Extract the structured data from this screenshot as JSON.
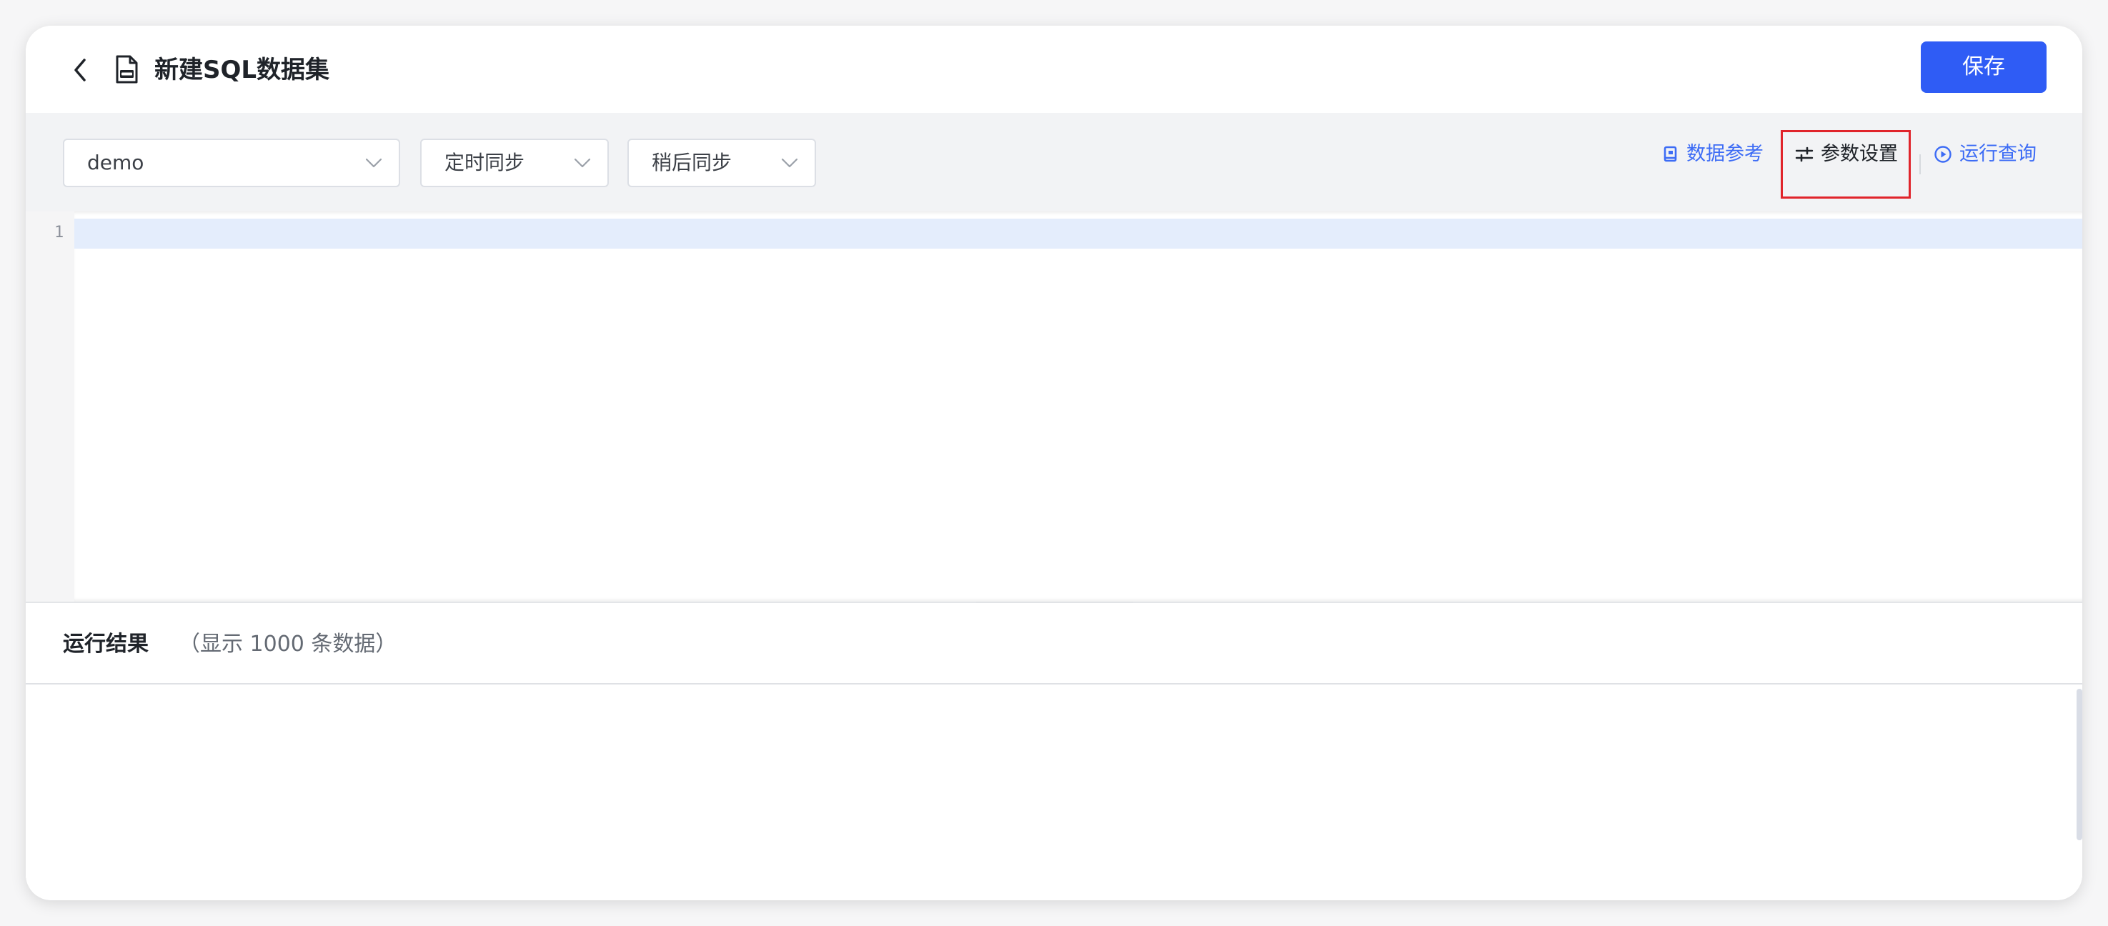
{
  "header": {
    "title": "新建SQL数据集",
    "save_label": "保存",
    "back_icon": "chevron-left-icon",
    "file_icon": "sql-file-icon"
  },
  "toolbar": {
    "datasource_select": {
      "value": "demo"
    },
    "sync_mode_select": {
      "value": "定时同步"
    },
    "sync_time_select": {
      "value": "稍后同步"
    },
    "data_reference_label": "数据参考",
    "parameter_settings_label": "参数设置",
    "run_query_label": "运行查询"
  },
  "editor": {
    "line_numbers": [
      "1"
    ],
    "content": ""
  },
  "results": {
    "title": "运行结果",
    "subtitle": "（显示 1000 条数据）"
  },
  "colors": {
    "primary": "#2f5cf5",
    "link": "#3d6cf5",
    "highlight_box": "#e0242b",
    "active_line": "#e4edfc",
    "toolbar_bg": "#f2f3f5"
  }
}
